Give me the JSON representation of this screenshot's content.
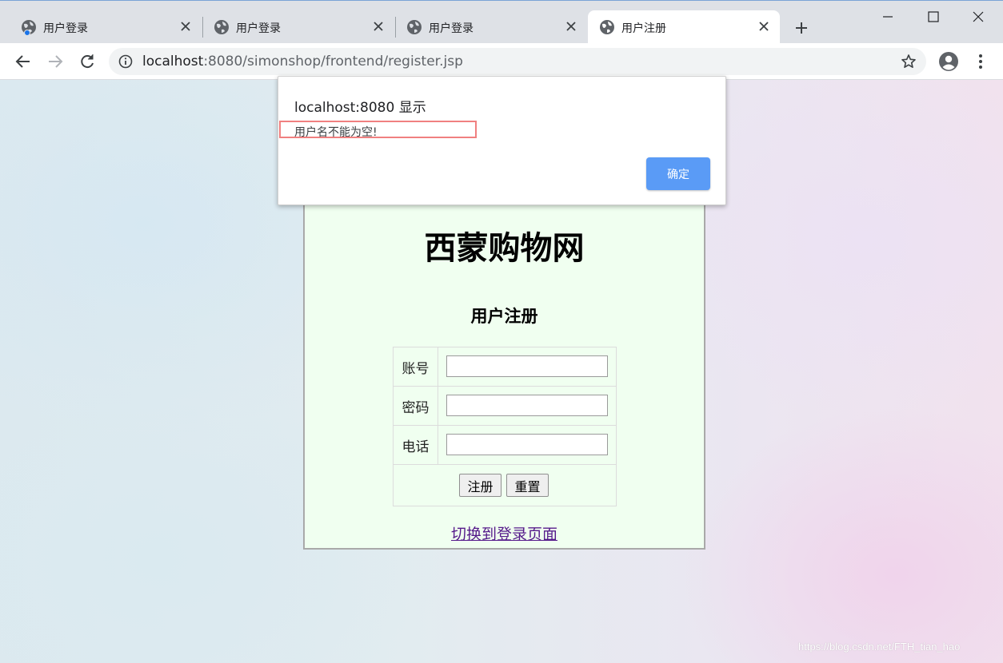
{
  "browser": {
    "tabs": [
      {
        "title": "用户登录",
        "active": false
      },
      {
        "title": "用户登录",
        "active": false
      },
      {
        "title": "用户登录",
        "active": false
      },
      {
        "title": "用户注册",
        "active": true
      }
    ],
    "url_host": "localhost",
    "url_path": ":8080/simonshop/frontend/register.jsp"
  },
  "page": {
    "site_title": "西蒙购物网",
    "form_title": "用户注册",
    "fields": [
      {
        "label": "账号",
        "value": ""
      },
      {
        "label": "密码",
        "value": ""
      },
      {
        "label": "电话",
        "value": ""
      }
    ],
    "register_button": "注册",
    "reset_button": "重置",
    "switch_link": "切换到登录页面"
  },
  "dialog": {
    "title": "localhost:8080 显示",
    "message": "用户名不能为空!",
    "ok_label": "确定"
  },
  "watermark": "https://blog.csdn.net/FTH_tian_hao",
  "colors": {
    "tabstrip": "#dee1e6",
    "panel_bg": "#f0fff0",
    "ok_button": "#5a9bf6",
    "highlight_box": "#f08080",
    "link": "#551a8b"
  }
}
